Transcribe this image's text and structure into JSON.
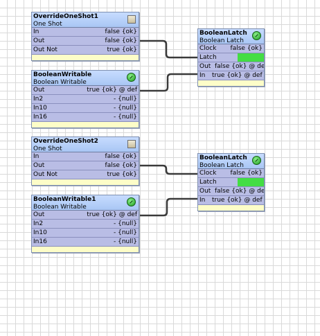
{
  "blocks": {
    "override1": {
      "title": "OverrideOneShot1",
      "subtitle": "One Shot",
      "icon": "override-status-box-icon",
      "slots": [
        {
          "label": "In",
          "value": "false {ok}"
        },
        {
          "label": "Out",
          "value": "false {ok}"
        },
        {
          "label": "Out Not",
          "value": "true {ok}"
        }
      ]
    },
    "writable": {
      "title": "BooleanWritable",
      "subtitle": "Boolean Writable",
      "icon": "ok-status-icon",
      "slots": [
        {
          "label": "Out",
          "value": "true {ok} @ def"
        },
        {
          "label": "In2",
          "value": "- {null}"
        },
        {
          "label": "In10",
          "value": "- {null}"
        },
        {
          "label": "In16",
          "value": "- {null}"
        }
      ]
    },
    "latch1": {
      "title": "BooleanLatch",
      "subtitle": "Boolean Latch",
      "icon": "ok-status-icon",
      "slots": [
        {
          "label": "Clock",
          "value": "false {ok}"
        },
        {
          "label": "Latch",
          "value": ""
        },
        {
          "label": "Out",
          "value": "false {ok} @ de"
        },
        {
          "label": "In",
          "value": "true {ok} @ def"
        }
      ]
    },
    "override2": {
      "title": "OverrideOneShot2",
      "subtitle": "One Shot",
      "icon": "override-status-box-icon",
      "slots": [
        {
          "label": "In",
          "value": "false {ok}"
        },
        {
          "label": "Out",
          "value": "false {ok}"
        },
        {
          "label": "Out Not",
          "value": "true {ok}"
        }
      ]
    },
    "writable1": {
      "title": "BooleanWritable1",
      "subtitle": "Boolean Writable",
      "icon": "ok-status-icon",
      "slots": [
        {
          "label": "Out",
          "value": "true {ok} @ def"
        },
        {
          "label": "In2",
          "value": "- {null}"
        },
        {
          "label": "In10",
          "value": "- {null}"
        },
        {
          "label": "In16",
          "value": "- {null}"
        }
      ]
    },
    "latch2": {
      "title": "BooleanLatch",
      "subtitle": "Boolean Latch",
      "icon": "ok-status-icon",
      "slots": [
        {
          "label": "Clock",
          "value": "false {ok}"
        },
        {
          "label": "Latch",
          "value": ""
        },
        {
          "label": "Out",
          "value": "false {ok} @ de"
        },
        {
          "label": "In",
          "value": "true {ok} @ def"
        }
      ]
    }
  },
  "colors": {
    "header": "#b3cdf6",
    "slot": "#b9bde5",
    "latch_active": "#44dd44",
    "footer": "#fdfdc8",
    "wire": "#333333"
  }
}
